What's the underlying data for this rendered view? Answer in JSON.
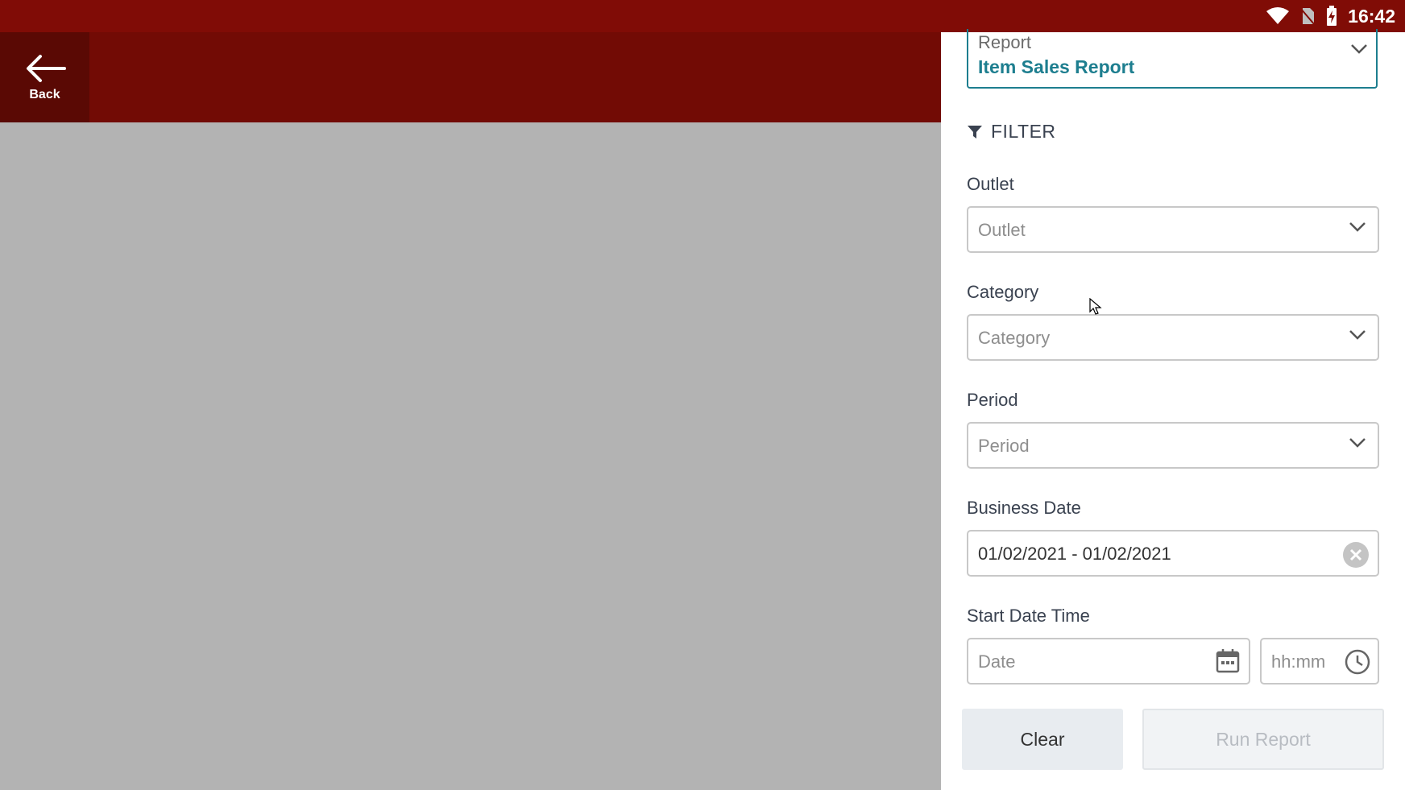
{
  "status_bar": {
    "time": "16:42"
  },
  "app_bar": {
    "back_label": "Back"
  },
  "panel": {
    "report": {
      "label": "Report",
      "value": "Item Sales Report"
    },
    "filter_title": "FILTER",
    "outlet": {
      "label": "Outlet",
      "placeholder": "Outlet"
    },
    "category": {
      "label": "Category",
      "placeholder": "Category"
    },
    "period": {
      "label": "Period",
      "placeholder": "Period"
    },
    "business_date": {
      "label": "Business Date",
      "value": "01/02/2021 - 01/02/2021"
    },
    "start_date_time": {
      "label": "Start Date Time",
      "date_placeholder": "Date",
      "time_placeholder": "hh:mm"
    },
    "buttons": {
      "clear": "Clear",
      "run_report": "Run Report"
    }
  },
  "colors": {
    "status_bar": "#800c06",
    "app_bar": "#720b05",
    "accent": "#1d7e8f",
    "backdrop": "#b3b3b3"
  }
}
